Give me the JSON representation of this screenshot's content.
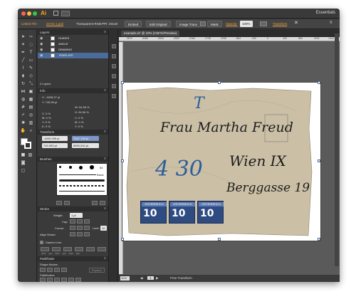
{
  "titlebar": {
    "app_logo": "Ai",
    "workspace": "Essentials"
  },
  "controlbar": {
    "selection_label": "Linked File",
    "filename": "20-01-1.psd",
    "color_info": "Transparent RGB",
    "ppi": "PPI: 19x18",
    "embed_btn": "Embed",
    "edit_original_btn": "Edit Original",
    "image_trace_btn": "Image Trace",
    "mask_btn": "Mask",
    "opacity_label": "Opacity:",
    "opacity_value": "100%",
    "transform_label": "Transform"
  },
  "layers_panel": {
    "tab": "Layers",
    "layers": [
      {
        "name": "GUIDES"
      },
      {
        "name": "ANGLE"
      },
      {
        "name": "DRAWING"
      },
      {
        "name": "TEMPLATE"
      }
    ],
    "footer": "4 Layers"
  },
  "info_panel": {
    "tab": "Info",
    "x": "X: -1608,37 pt",
    "y": "Y: 745,95 pt",
    "w": "W: 94,96 %",
    "h": "H: 94,96 %",
    "cmyk_left": [
      "C: 0 %",
      "M: 0 %",
      "Y: 0 %",
      "K: 0 %"
    ],
    "cmyk_right": [
      "C: 0 %",
      "M: 0 %",
      "Y: 0 %",
      "K: 0 %"
    ]
  },
  "transform_panel": {
    "tab": "Transform",
    "x": "-1609,395 pt",
    "y": "745,953 pt",
    "w": "7647,138 pt",
    "h": "6590,034 pt"
  },
  "brushes_panel": {
    "tab": "Brushes",
    "brush_size": "84",
    "basic_label": "Basic"
  },
  "stroke_panel": {
    "tab": "Stroke",
    "weight_label": "Weight:",
    "weight_value": "1 pt",
    "cap_label": "Cap:",
    "corner_label": "Corner:",
    "limit_label": "Limit:",
    "limit_value": "10",
    "align_label": "Align Stroke:",
    "dashed_label": "Dashed Line",
    "dash_labels": [
      "dash",
      "gap",
      "dash",
      "gap",
      "dash",
      "gap"
    ]
  },
  "pathfinder_panel": {
    "tab": "Pathfinder",
    "shape_modes": "Shape Modes:",
    "pathfinders": "Pathfinders:",
    "expand_btn": "Expand"
  },
  "document": {
    "tab_label": "example.ai* @ 10% (CMYK/Preview)",
    "ruler_ticks": [
      "-3870",
      "-3456",
      "-3000",
      "-2592",
      "-2160",
      "-1728",
      "-1296",
      "-864",
      "-432",
      "0",
      "432",
      "864",
      "1152",
      "1440"
    ],
    "zoom": "10%",
    "artboard_nav": "1",
    "status": "Free Transform"
  },
  "envelope": {
    "text_T": "T",
    "address_line1": "Frau Martha Freud",
    "address_line2": "Wien IX",
    "address_line3": "Berggasse 19",
    "blue_notation": "4 30",
    "stamps": [
      {
        "band": "ÖSTERREICH",
        "value": "10"
      },
      {
        "band": "ÖSTERREICH",
        "value": "10"
      },
      {
        "band": "ÖSTERREICH",
        "value": "10"
      }
    ]
  },
  "colors": {
    "accent_orange": "#f0a040",
    "selection_blue": "#4a6c9a",
    "stamp_blue": "#2e4b82",
    "envelope_paper": "#cbc0a6"
  }
}
